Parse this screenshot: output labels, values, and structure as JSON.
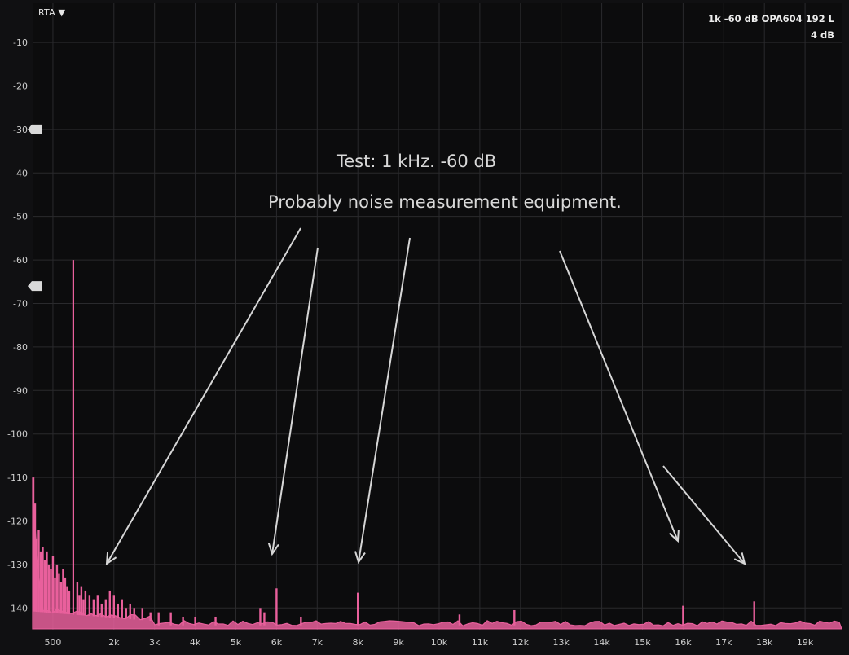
{
  "rta_menu": {
    "label": "RTA ▼"
  },
  "series_info": {
    "name": "1k -60 dB OPA604 192 L",
    "range": "4 dB"
  },
  "colors": {
    "background": "#101012",
    "plot_bg": "#0c0c0d",
    "grid": "#2a2a2d",
    "trace": "#e9609c",
    "arrow": "#d6d6d6",
    "text": "#cfcfcf"
  },
  "chart_data": {
    "type": "line",
    "title": "",
    "annotations": [
      "Test: 1 kHz. -60 dB",
      "Probably noise measurement equipment."
    ],
    "xlabel": "",
    "ylabel": "",
    "xlim": [
      0,
      19900
    ],
    "ylim": [
      -145,
      -1
    ],
    "x_ticks": [
      500,
      2000,
      3000,
      4000,
      5000,
      6000,
      7000,
      8000,
      9000,
      10000,
      11000,
      12000,
      13000,
      14000,
      15000,
      16000,
      17000,
      18000,
      19000
    ],
    "x_tick_labels": [
      "500",
      "2k",
      "3k",
      "4k",
      "5k",
      "6k",
      "7k",
      "8k",
      "9k",
      "10k",
      "11k",
      "12k",
      "13k",
      "14k",
      "15k",
      "16k",
      "17k",
      "18k",
      "19k"
    ],
    "y_ticks": [
      -10,
      -20,
      -30,
      -40,
      -50,
      -60,
      -70,
      -80,
      -90,
      -100,
      -110,
      -120,
      -130,
      -140
    ],
    "y_tick_labels": [
      "-10",
      "-20",
      "-30",
      "-40",
      "-50",
      "-60",
      "-70",
      "-80",
      "-90",
      "-100",
      "-110",
      "-120",
      "-130",
      "-140"
    ],
    "markers_y": [
      -30,
      -66
    ],
    "grid": true,
    "noise_floor": -143.5,
    "series": [
      {
        "name": "1k -60 dB OPA604 192 L",
        "peaks": [
          {
            "x": 20,
            "y": -110
          },
          {
            "x": 60,
            "y": -116
          },
          {
            "x": 100,
            "y": -124
          },
          {
            "x": 150,
            "y": -122
          },
          {
            "x": 200,
            "y": -127
          },
          {
            "x": 250,
            "y": -126
          },
          {
            "x": 300,
            "y": -129
          },
          {
            "x": 350,
            "y": -127
          },
          {
            "x": 400,
            "y": -130
          },
          {
            "x": 450,
            "y": -131
          },
          {
            "x": 500,
            "y": -128
          },
          {
            "x": 550,
            "y": -133
          },
          {
            "x": 600,
            "y": -130
          },
          {
            "x": 650,
            "y": -132
          },
          {
            "x": 700,
            "y": -134
          },
          {
            "x": 750,
            "y": -131
          },
          {
            "x": 800,
            "y": -133
          },
          {
            "x": 850,
            "y": -135
          },
          {
            "x": 900,
            "y": -136
          },
          {
            "x": 1000,
            "y": -60
          },
          {
            "x": 1100,
            "y": -134
          },
          {
            "x": 1150,
            "y": -137
          },
          {
            "x": 1200,
            "y": -135
          },
          {
            "x": 1250,
            "y": -138
          },
          {
            "x": 1300,
            "y": -136
          },
          {
            "x": 1400,
            "y": -137
          },
          {
            "x": 1500,
            "y": -138
          },
          {
            "x": 1600,
            "y": -137
          },
          {
            "x": 1700,
            "y": -139
          },
          {
            "x": 1800,
            "y": -138
          },
          {
            "x": 1900,
            "y": -136
          },
          {
            "x": 2000,
            "y": -137
          },
          {
            "x": 2100,
            "y": -139
          },
          {
            "x": 2200,
            "y": -138
          },
          {
            "x": 2300,
            "y": -140
          },
          {
            "x": 2400,
            "y": -139
          },
          {
            "x": 2500,
            "y": -140
          },
          {
            "x": 2700,
            "y": -140
          },
          {
            "x": 2900,
            "y": -141
          },
          {
            "x": 3100,
            "y": -141
          },
          {
            "x": 3400,
            "y": -141
          },
          {
            "x": 3700,
            "y": -142
          },
          {
            "x": 4000,
            "y": -142
          },
          {
            "x": 4500,
            "y": -142
          },
          {
            "x": 5600,
            "y": -140
          },
          {
            "x": 5700,
            "y": -141
          },
          {
            "x": 6000,
            "y": -135.5
          },
          {
            "x": 6600,
            "y": -142
          },
          {
            "x": 8000,
            "y": -136.5
          },
          {
            "x": 10500,
            "y": -141.5
          },
          {
            "x": 11850,
            "y": -140.5
          },
          {
            "x": 16000,
            "y": -139.5
          },
          {
            "x": 17750,
            "y": -138.5
          }
        ]
      }
    ]
  }
}
